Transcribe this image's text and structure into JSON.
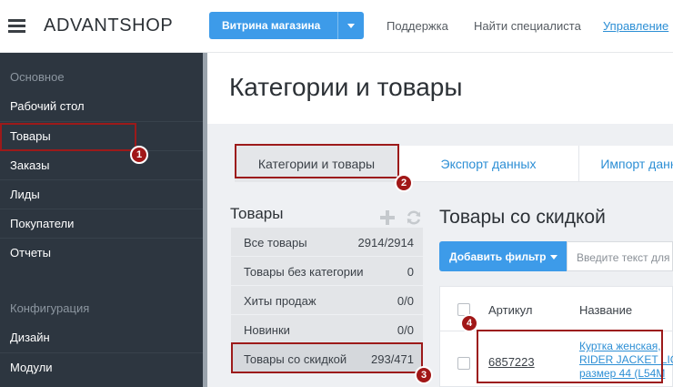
{
  "header": {
    "logo": "ADVANTSHOP",
    "storefront_button": "Витрина магазина",
    "links": [
      "Поддержка",
      "Найти специалиста",
      "Управление"
    ]
  },
  "sidebar": {
    "section_main": "Основное",
    "main_items": [
      "Рабочий стол",
      "Товары",
      "Заказы",
      "Лиды",
      "Покупатели",
      "Отчеты"
    ],
    "section_config": "Конфигурация",
    "config_items": [
      "Дизайн",
      "Модули"
    ]
  },
  "page": {
    "title": "Категории и товары",
    "tabs": [
      "Категории и товары",
      "Экспорт данных",
      "Импорт данных"
    ]
  },
  "categories": {
    "title": "Товары",
    "items": [
      {
        "name": "Все товары",
        "count": "2914/2914"
      },
      {
        "name": "Товары без категории",
        "count": "0"
      },
      {
        "name": "Хиты продаж",
        "count": "0/0"
      },
      {
        "name": "Новинки",
        "count": "0/0"
      },
      {
        "name": "Товары со скидкой",
        "count": "293/471"
      }
    ]
  },
  "products": {
    "title": "Товары со скидкой",
    "add_filter": "Добавить фильтр",
    "search_placeholder": "Введите текст для",
    "columns": [
      "Артикул",
      "Название"
    ],
    "rows": [
      {
        "sku": "6857223",
        "name_lines": [
          "Куртка женская,",
          "RIDER JACKET LIG",
          "размер 44 (L54M"
        ]
      }
    ]
  },
  "annotations": [
    "1",
    "2",
    "3",
    "4"
  ],
  "colors": {
    "sidebar_bg": "#2d3640",
    "accent": "#3d9be9",
    "annotation": "#a11717"
  }
}
